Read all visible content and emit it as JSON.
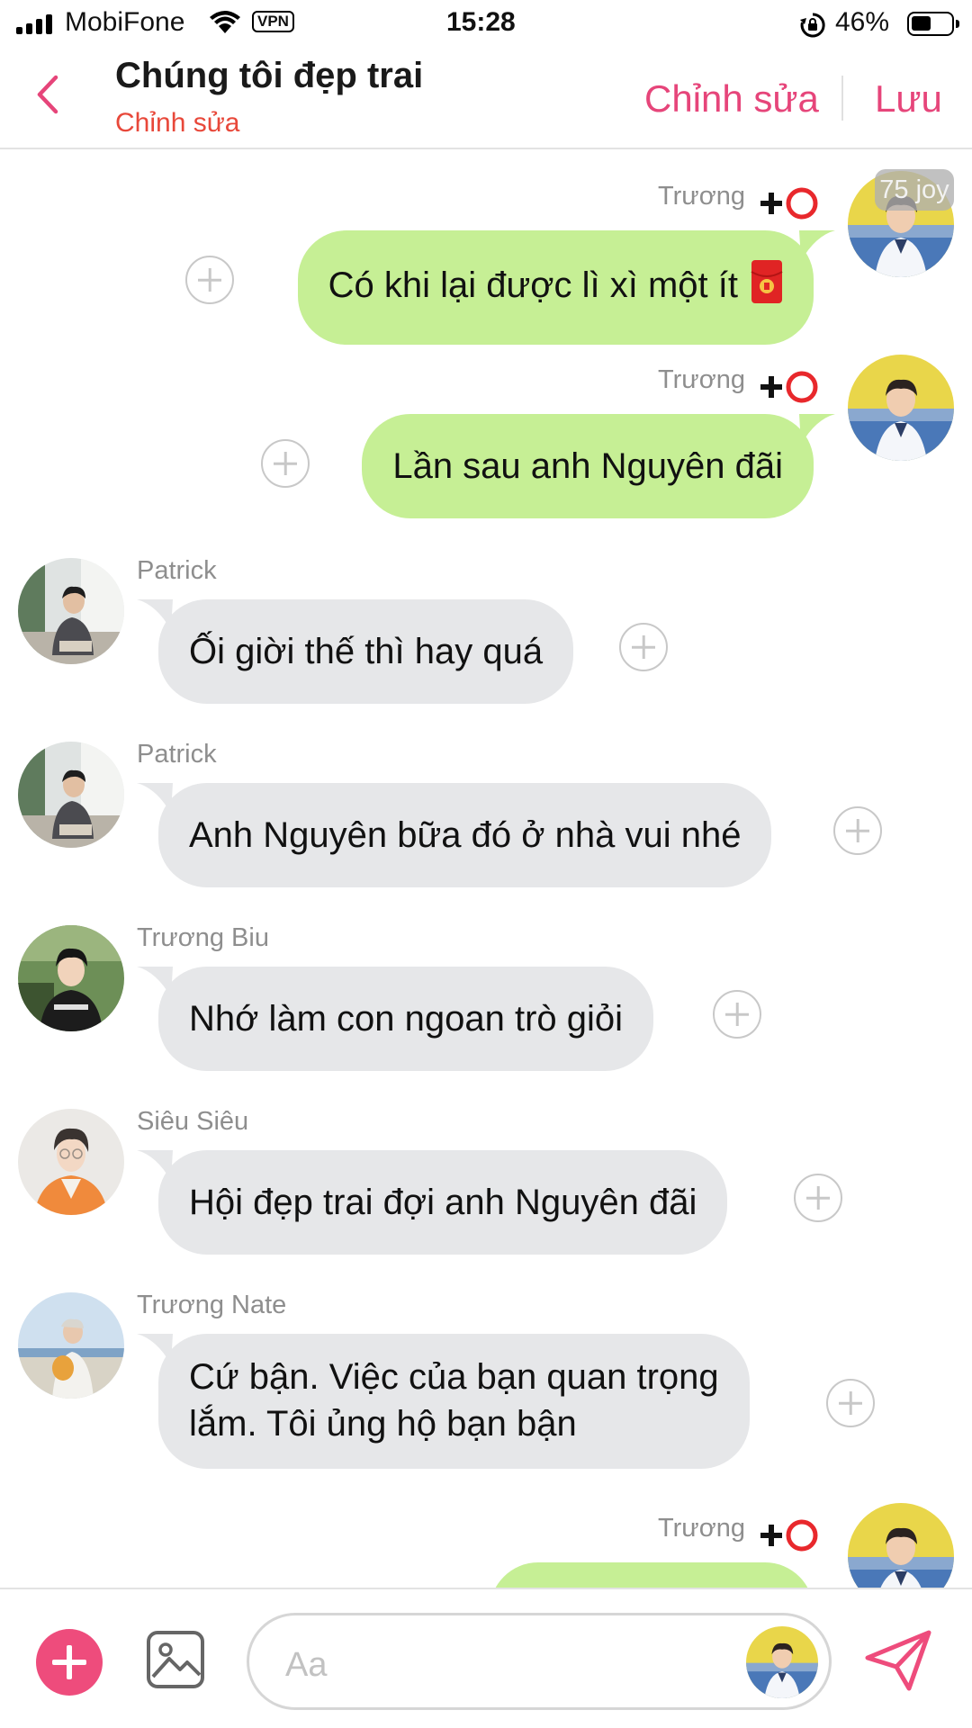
{
  "status_bar": {
    "carrier": "MobiFone",
    "vpn": "VPN",
    "time": "15:28",
    "battery": "46%"
  },
  "header": {
    "title": "Chúng tôi đẹp trai",
    "subtitle": "Chỉnh sửa",
    "edit_label": "Chỉnh sửa",
    "save_label": "Lưu"
  },
  "messages": [
    {
      "side": "me",
      "sender": "Trương",
      "text": "Có khi lại được lì xì một ít",
      "badge": "75 joy"
    },
    {
      "side": "me",
      "sender": "Trương",
      "text": "Lần sau anh Nguyên đãi"
    },
    {
      "side": "them",
      "sender": "Patrick",
      "text": "Ối giời thế thì hay quá"
    },
    {
      "side": "them",
      "sender": "Patrick",
      "text": "Anh Nguyên bữa đó ở nhà vui nhé"
    },
    {
      "side": "them",
      "sender": "Trương Biu",
      "text": "Nhớ làm con ngoan trò giỏi"
    },
    {
      "side": "them",
      "sender": "Siêu Siêu",
      "text": "Hội đẹp trai đợi anh Nguyên đãi"
    },
    {
      "side": "them",
      "sender": "Trương Nate",
      "text_line1": "Cứ bận. Việc của bạn quan trọng",
      "text_line2": "lắm. Tôi ủng hộ bạn bận"
    },
    {
      "side": "me",
      "sender": "Trương",
      "text": ""
    }
  ],
  "composer": {
    "placeholder": "Aa"
  },
  "colors": {
    "accent": "#ee4c7c",
    "outgoing_bubble": "#c6ef95",
    "incoming_bubble": "#e6e7e9",
    "subtitle": "#e8483a"
  },
  "icons": [
    "back-chevron-icon",
    "plus-icon",
    "red-circle-icon",
    "red-envelope-icon",
    "add-circle-icon",
    "image-icon",
    "send-icon"
  ]
}
